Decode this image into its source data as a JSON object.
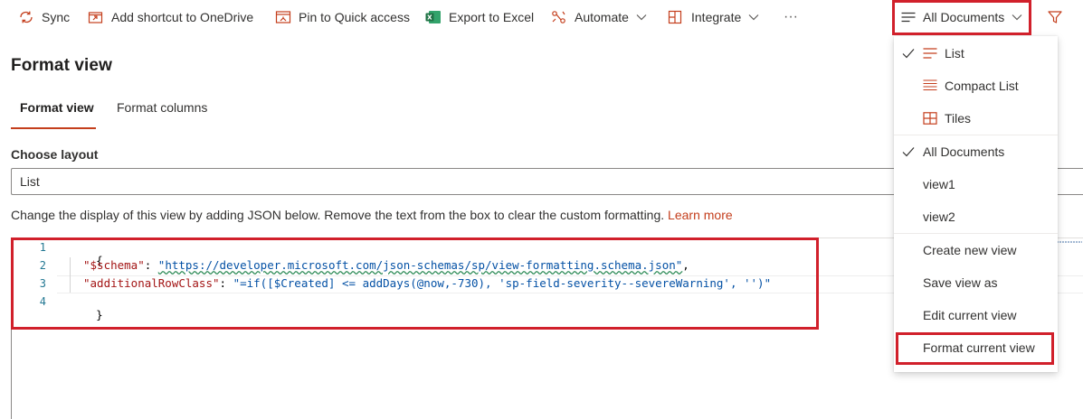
{
  "commandbar": {
    "items": [
      {
        "label": "Sync",
        "icon": "sync-icon"
      },
      {
        "label": "Add shortcut to OneDrive",
        "icon": "add-shortcut-icon"
      },
      {
        "label": "Pin to Quick access",
        "icon": "pin-icon"
      },
      {
        "label": "Export to Excel",
        "icon": "excel-icon"
      },
      {
        "label": "Automate",
        "icon": "automate-icon"
      },
      {
        "label": "Integrate",
        "icon": "integrate-icon"
      }
    ],
    "more": "···",
    "view_switcher": {
      "label": "All Documents",
      "icon": "list-lines-icon"
    },
    "filter_icon": "filter-icon"
  },
  "pane": {
    "title": "Format view",
    "tabs": [
      {
        "label": "Format view",
        "active": true
      },
      {
        "label": "Format columns",
        "active": false
      }
    ],
    "layout_label": "Choose layout",
    "layout_value": "List",
    "help_text": "Change the display of this view by adding JSON below. Remove the text from the box to clear the custom formatting.",
    "learn_more": "Learn more"
  },
  "editor": {
    "line_numbers": [
      "1",
      "2",
      "3",
      "4"
    ],
    "line1": "{",
    "line2_key": "\"$schema\"",
    "line2_colon": ": ",
    "line2_value": "\"https://developer.microsoft.com/json-schemas/sp/view-formatting.schema.json\"",
    "line2_comma": ",",
    "line3_key": "\"additionalRowClass\"",
    "line3_colon": ": ",
    "line3_value": "\"=if([$Created] <= addDays(@now,-730), 'sp-field-severity--severeWarning', '')\"",
    "line4": "}"
  },
  "menu": {
    "layouts": [
      {
        "label": "List",
        "icon": "list-lines-icon",
        "checked": true
      },
      {
        "label": "Compact List",
        "icon": "compact-list-icon",
        "checked": false
      },
      {
        "label": "Tiles",
        "icon": "tiles-icon",
        "checked": false
      }
    ],
    "views": [
      {
        "label": "All Documents",
        "checked": true
      },
      {
        "label": "view1",
        "checked": false
      },
      {
        "label": "view2",
        "checked": false
      }
    ],
    "actions": [
      {
        "label": "Create new view"
      },
      {
        "label": "Save view as"
      },
      {
        "label": "Edit current view"
      },
      {
        "label": "Format current view"
      }
    ]
  },
  "colors": {
    "accent": "#c43e1c",
    "highlight": "#d1202b",
    "excel_green": "#217346",
    "json_key": "#a31515",
    "json_string": "#0451a5",
    "line_number": "#237893"
  }
}
